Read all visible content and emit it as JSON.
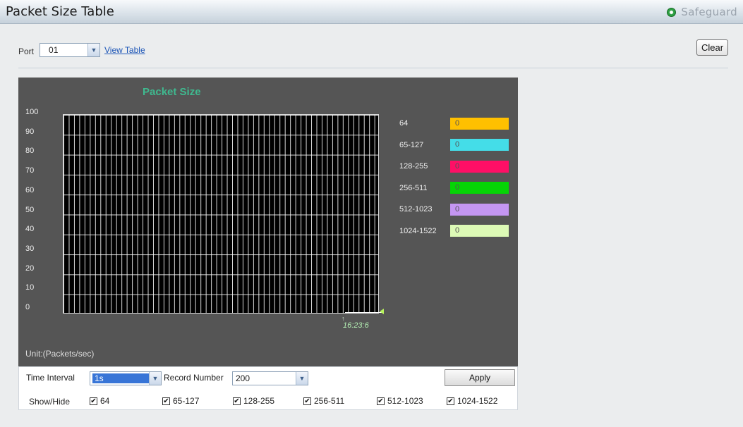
{
  "header": {
    "title": "Packet Size Table",
    "brand": "Safeguard",
    "brand_color": "#2ea043"
  },
  "port_row": {
    "label": "Port",
    "selected": "01",
    "view_link": "View Table"
  },
  "clear_label": "Clear",
  "chart": {
    "title": "Packet Size",
    "unit": "Unit:(Packets/sec)",
    "time_label": "16:23:6"
  },
  "chart_data": {
    "type": "line",
    "title": "Packet Size",
    "ylabel": "Unit:(Packets/sec)",
    "ylim": [
      0,
      100
    ],
    "y_ticks": [
      "100",
      "90",
      "80",
      "70",
      "60",
      "50",
      "40",
      "30",
      "20",
      "10",
      "0"
    ],
    "x": [
      "16:23:6"
    ],
    "grid": true,
    "legend_position": "right",
    "series": [
      {
        "name": "64",
        "values": [
          0
        ],
        "color": "#ffc000"
      },
      {
        "name": "65-127",
        "values": [
          0
        ],
        "color": "#44dde8"
      },
      {
        "name": "128-255",
        "values": [
          0
        ],
        "color": "#ff0f66"
      },
      {
        "name": "256-511",
        "values": [
          0
        ],
        "color": "#05d405"
      },
      {
        "name": "512-1023",
        "values": [
          0
        ],
        "color": "#c496f2"
      },
      {
        "name": "1024-1522",
        "values": [
          0
        ],
        "color": "#ddfab6"
      }
    ]
  },
  "controls": {
    "time_interval_label": "Time Interval",
    "time_interval_value": "1s",
    "record_number_label": "Record Number",
    "record_number_value": "200",
    "apply_label": "Apply",
    "show_hide_label": "Show/Hide",
    "checkboxes": [
      {
        "label": "64",
        "checked": true
      },
      {
        "label": "65-127",
        "checked": true
      },
      {
        "label": "128-255",
        "checked": true
      },
      {
        "label": "256-511",
        "checked": true
      },
      {
        "label": "512-1023",
        "checked": true
      },
      {
        "label": "1024-1522",
        "checked": true
      }
    ]
  }
}
